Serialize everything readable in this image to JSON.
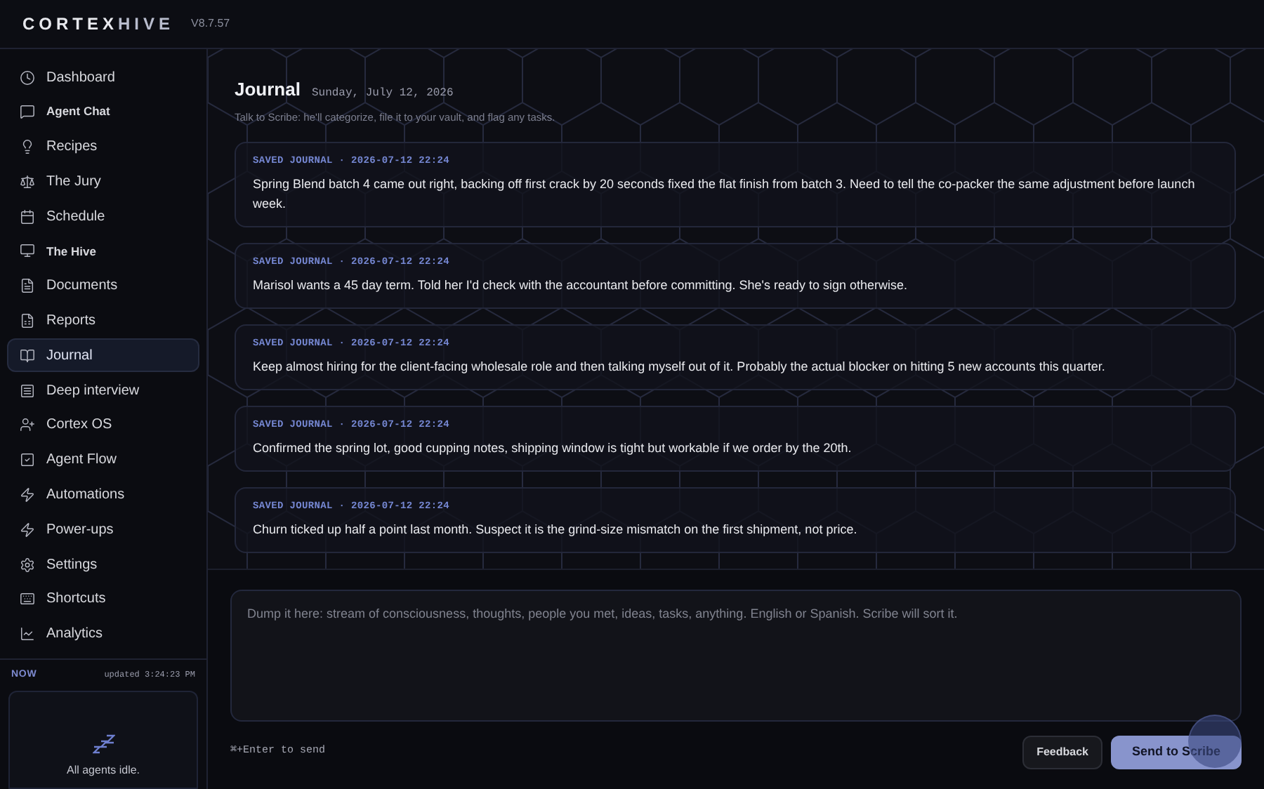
{
  "brand": {
    "name_left": "CORTEX",
    "name_right": "HIVE",
    "version": "V8.7.57"
  },
  "sidebar": {
    "items": [
      {
        "label": "Dashboard",
        "kind": "normal",
        "selected": false
      },
      {
        "label": "Agent Chat",
        "kind": "compact",
        "selected": false
      },
      {
        "label": "Recipes",
        "kind": "normal",
        "selected": false
      },
      {
        "label": "The Jury",
        "kind": "normal",
        "selected": false
      },
      {
        "label": "Schedule",
        "kind": "normal",
        "selected": false
      },
      {
        "label": "The Hive",
        "kind": "compact",
        "selected": false
      },
      {
        "label": "Documents",
        "kind": "normal",
        "selected": false
      },
      {
        "label": "Reports",
        "kind": "normal",
        "selected": false
      },
      {
        "label": "Journal",
        "kind": "normal",
        "selected": true
      },
      {
        "label": "Deep interview",
        "kind": "normal",
        "selected": false
      },
      {
        "label": "Cortex OS",
        "kind": "normal",
        "selected": false
      },
      {
        "label": "Agent Flow",
        "kind": "normal",
        "selected": false
      },
      {
        "label": "Automations",
        "kind": "normal",
        "selected": false
      },
      {
        "label": "Power-ups",
        "kind": "normal",
        "selected": false
      },
      {
        "label": "Settings",
        "kind": "normal",
        "selected": false
      },
      {
        "label": "Shortcuts",
        "kind": "normal",
        "selected": false
      },
      {
        "label": "Analytics",
        "kind": "normal",
        "selected": false
      }
    ]
  },
  "now_panel": {
    "label": "NOW",
    "updated": "updated 3:24:23 PM",
    "status": "All agents idle."
  },
  "journal": {
    "title": "Journal",
    "date": "Sunday, July 12, 2026",
    "subtitle": "Talk to Scribe: he'll categorize, file it to your vault, and flag any tasks.",
    "entries": [
      {
        "meta": "SAVED JOURNAL · 2026-07-12 22:24",
        "text": "Spring Blend batch 4 came out right, backing off first crack by 20 seconds fixed the flat finish from batch 3. Need to tell the co-packer the same adjustment before launch week."
      },
      {
        "meta": "SAVED JOURNAL · 2026-07-12 22:24",
        "text": "Marisol wants a 45 day term. Told her I'd check with the accountant before committing. She's ready to sign otherwise."
      },
      {
        "meta": "SAVED JOURNAL · 2026-07-12 22:24",
        "text": "Keep almost hiring for the client-facing wholesale role and then talking myself out of it. Probably the actual blocker on hitting 5 new accounts this quarter."
      },
      {
        "meta": "SAVED JOURNAL · 2026-07-12 22:24",
        "text": "Confirmed the spring lot, good cupping notes, shipping window is tight but workable if we order by the 20th."
      },
      {
        "meta": "SAVED JOURNAL · 2026-07-12 22:24",
        "text": "Churn ticked up half a point last month. Suspect it is the grind-size mismatch on the first shipment, not price."
      }
    ]
  },
  "composer": {
    "placeholder": "Dump it here: stream of consciousness, thoughts, people you met, ideas, tasks, anything. English or Spanish. Scribe will sort it.",
    "hint": "⌘+Enter to send",
    "buttons": [
      {
        "label": "Feedback",
        "kind": "secondary"
      },
      {
        "label": "Send to Scribe",
        "kind": "primary"
      }
    ]
  }
}
